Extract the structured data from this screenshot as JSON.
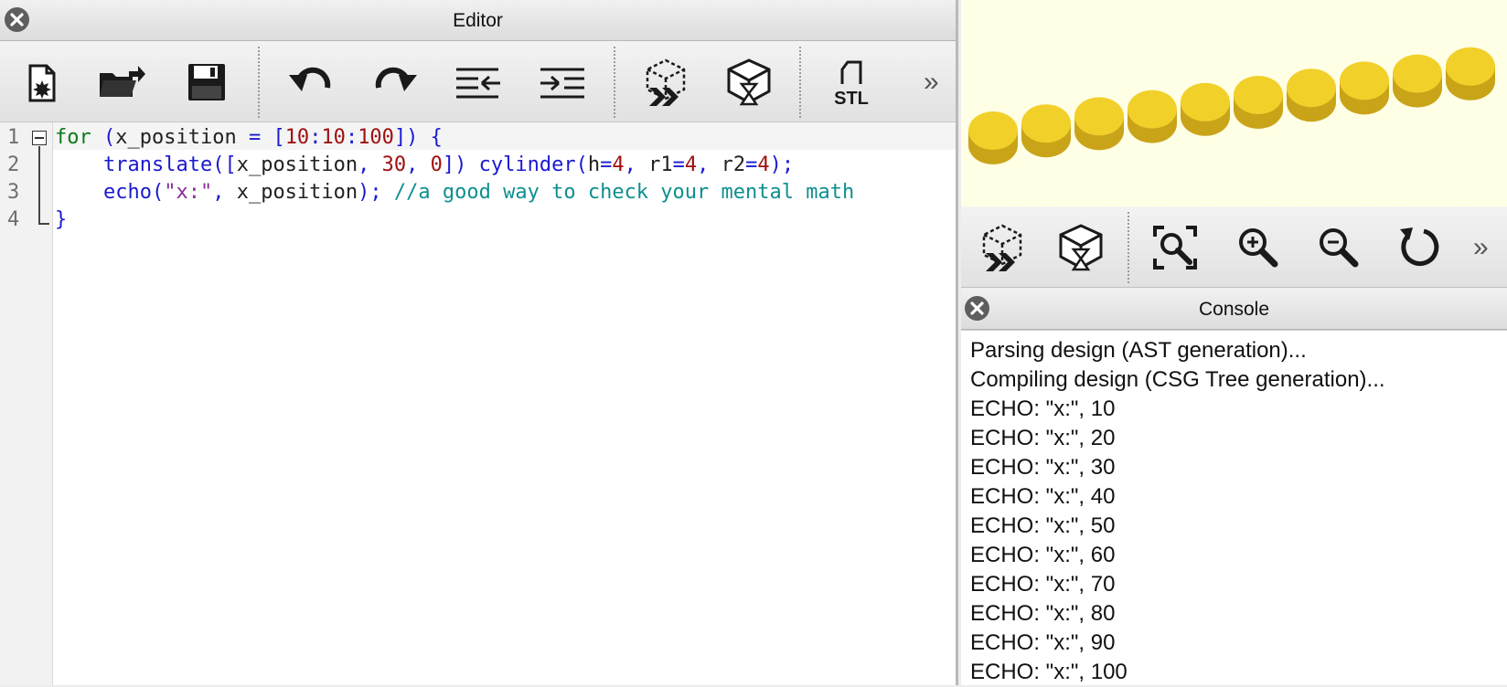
{
  "editor": {
    "title": "Editor",
    "toolbar": [
      "new-file",
      "open-file",
      "save-file",
      "undo",
      "redo",
      "unindent",
      "indent",
      "preview",
      "render",
      "export-stl"
    ],
    "stl_label": "STL",
    "more": "»",
    "line_numbers": [
      "1",
      "2",
      "3",
      "4"
    ],
    "code": {
      "l1": {
        "kw": "for",
        "a": " (",
        "id1": "x_position",
        "b": " = [",
        "n1": "10",
        "c1": ":",
        "n2": "10",
        "c2": ":",
        "n3": "100",
        "d": "]) {"
      },
      "l2": {
        "indent": "    ",
        "fn": "translate",
        "a": "([",
        "id1": "x_position",
        "b": ", ",
        "n1": "30",
        "c": ", ",
        "n2": "0",
        "d": "]) ",
        "fn2": "cylinder",
        "e": "(",
        "p1": "h",
        "eq1": "=",
        "v1": "4",
        "s1": ", ",
        "p2": "r1",
        "eq2": "=",
        "v2": "4",
        "s2": ", ",
        "p3": "r2",
        "eq3": "=",
        "v3": "4",
        "f": ");"
      },
      "l3": {
        "indent": "    ",
        "fn": "echo",
        "a": "(",
        "str": "\"x:\"",
        "b": ", ",
        "id1": "x_position",
        "c": "); ",
        "cmt": "//a good way to check your mental math"
      },
      "l4": {
        "close": "}"
      }
    }
  },
  "viewer": {
    "background": "#ffffe5",
    "cylinder_color": "#f2d02a",
    "toolbar": [
      "preview",
      "render",
      "view-all",
      "zoom-in",
      "zoom-out",
      "reset-view"
    ],
    "more": "»"
  },
  "console": {
    "title": "Console",
    "lines": [
      "Parsing design (AST generation)...",
      "Compiling design (CSG Tree generation)...",
      "ECHO: \"x:\", 10",
      "ECHO: \"x:\", 20",
      "ECHO: \"x:\", 30",
      "ECHO: \"x:\", 40",
      "ECHO: \"x:\", 50",
      "ECHO: \"x:\", 60",
      "ECHO: \"x:\", 70",
      "ECHO: \"x:\", 80",
      "ECHO: \"x:\", 90",
      "ECHO: \"x:\", 100"
    ]
  }
}
